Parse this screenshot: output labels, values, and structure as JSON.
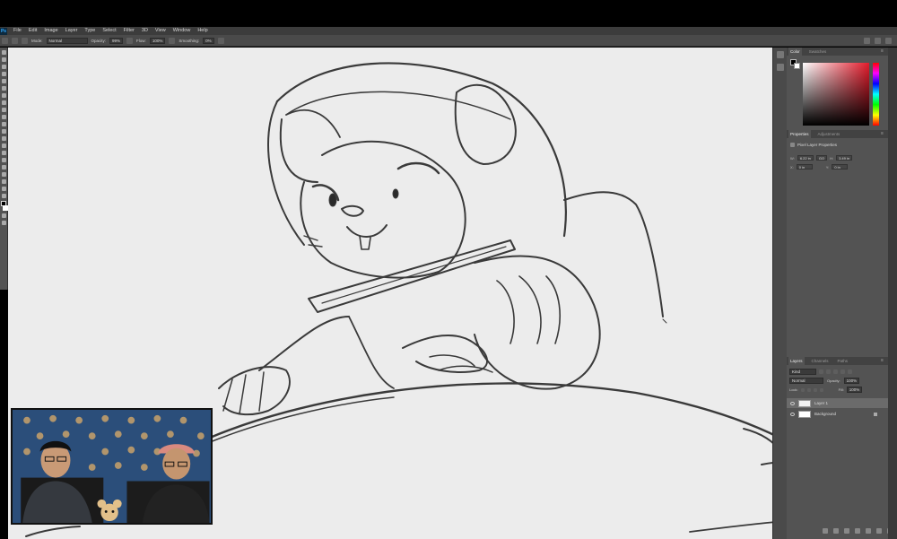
{
  "app": {
    "logo": "Ps"
  },
  "menu": [
    "File",
    "Edit",
    "Image",
    "Layer",
    "Type",
    "Select",
    "Filter",
    "3D",
    "View",
    "Window",
    "Help"
  ],
  "options_bar": {
    "mode_label": "Mode:",
    "mode_value": "Normal",
    "opacity_label": "Opacity:",
    "opacity_value": "99%",
    "flow_label": "Flow:",
    "flow_value": "100%",
    "smoothing_label": "Smoothing:",
    "smoothing_value": "0%"
  },
  "color_panel": {
    "tabs": [
      "Color",
      "Swatches"
    ],
    "foreground": "#000000",
    "background": "#ffffff",
    "hue": "#e31b2b"
  },
  "properties_panel": {
    "tabs": [
      "Properties",
      "Adjustments"
    ],
    "title": "Pixel Layer Properties",
    "w_label": "W:",
    "w_value": "6.22 in",
    "h_label": "H:",
    "h_value": "3.49 in",
    "x_label": "X:",
    "x_value": "0 in",
    "y_label": "Y:",
    "y_value": "0 in",
    "link": "GO"
  },
  "layers_panel": {
    "tabs": [
      "Layers",
      "Channels",
      "Paths"
    ],
    "filter_value": "Kind",
    "blend_mode": "Normal",
    "opacity_label": "Opacity:",
    "opacity_value": "100%",
    "lock_label": "Lock:",
    "fill_label": "Fill:",
    "fill_value": "100%",
    "layers": [
      {
        "name": "Layer 1",
        "selected": true
      },
      {
        "name": "Background",
        "selected": false
      }
    ]
  },
  "colors": {
    "canvas": "#ececec",
    "panel": "#535353",
    "menubar": "#3c3c3c",
    "sketch_stroke": "#3a3a3a",
    "webcam_wall": "#2b4e7a"
  }
}
